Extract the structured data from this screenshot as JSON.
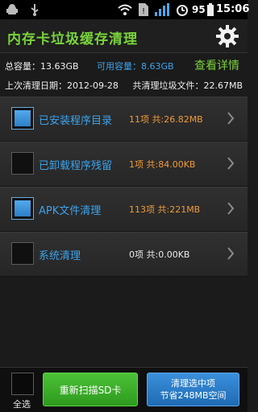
{
  "status_bar": {
    "battery_percent": "95",
    "time": "15:06",
    "icons": [
      "usb-icon",
      "android-debug-icon",
      "wifi-icon",
      "sim-icon",
      "signal-icon",
      "alarm-icon",
      "battery-icon"
    ]
  },
  "header": {
    "title": "内存卡垃圾缓存清理",
    "settings_icon": "gear-icon"
  },
  "summary": {
    "total_capacity": "总容量：13.63GB",
    "available_capacity": "可用容量：8.63GB",
    "details_link": "查看详情",
    "last_clean_date": "上次清理日期：2012-09-28",
    "total_cleaned": "共清理垃圾文件：22.67MB"
  },
  "items": [
    {
      "name": "已安装程序目录",
      "count": "11项  共:26.82MB",
      "checked": true,
      "color": "#ef9a3a"
    },
    {
      "name": "已卸载程序残留",
      "count": "1项  共:84.00KB",
      "checked": false,
      "color": "#ef9a3a"
    },
    {
      "name": "APK文件清理",
      "count": "113项  共:221MB",
      "checked": true,
      "color": "#ef9a3a"
    },
    {
      "name": "系统清理",
      "count": "0项  共:0.00KB",
      "checked": false,
      "color": "#e8e8e8"
    }
  ],
  "footer": {
    "select_all": "全选",
    "rescan_button": "重新扫描SD卡",
    "clean_button_line1": "清理选中项",
    "clean_button_line2": "节省248MB空间"
  },
  "colors": {
    "accent_green": "#79d33a",
    "accent_blue": "#3ba3ec",
    "orange": "#ef9a3a"
  }
}
